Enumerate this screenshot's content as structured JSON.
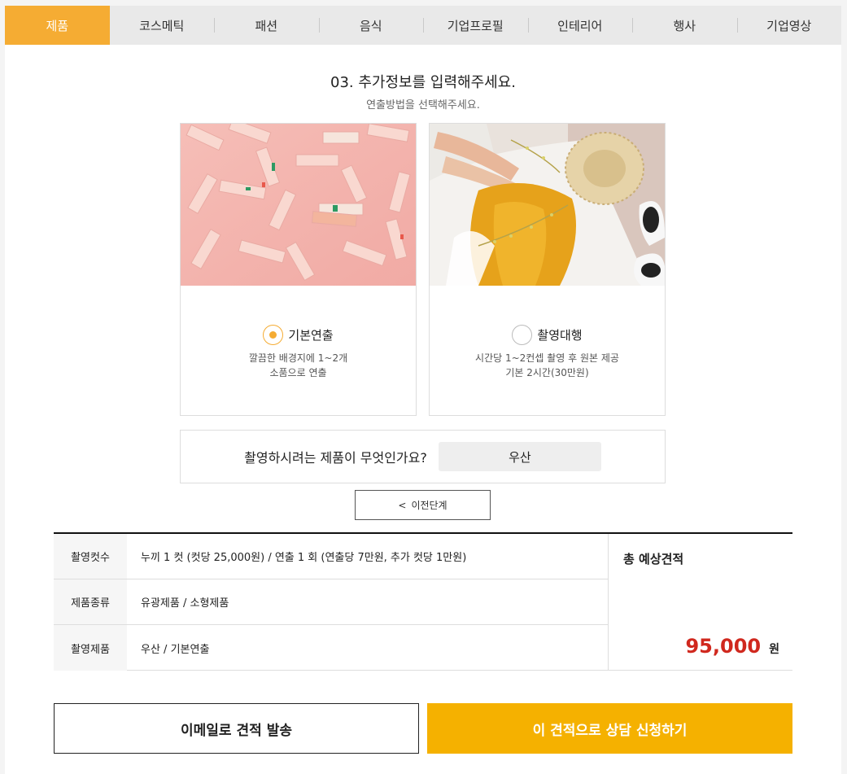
{
  "tabs": [
    {
      "label": "제품",
      "active": true
    },
    {
      "label": "코스메틱"
    },
    {
      "label": "패션"
    },
    {
      "label": "음식"
    },
    {
      "label": "기업프로필"
    },
    {
      "label": "인테리어"
    },
    {
      "label": "행사"
    },
    {
      "label": "기업영상"
    }
  ],
  "step": {
    "title": "03. 추가정보를 입력해주세요.",
    "subtitle": "연출방법을 선택해주세요."
  },
  "options": [
    {
      "label": "기본연출",
      "desc_line1": "깔끔한 배경지에 1~2개",
      "desc_line2": "소품으로 연출",
      "selected": true,
      "image": "pink-cosmetics-photo"
    },
    {
      "label": "촬영대행",
      "desc_line1": "시간당 1~2컨셉 촬영 후 원본 제공",
      "desc_line2": "기본 2시간(30만원)",
      "selected": false,
      "image": "picnic-clothes-photo"
    }
  ],
  "question": {
    "label": "촬영하시려는 제품이 무엇인가요?",
    "answer": "우산"
  },
  "prev_button": {
    "arrow": "<",
    "label": "이전단계"
  },
  "summary": {
    "rows": [
      {
        "key": "촬영컷수",
        "value": "누끼 1 컷 (컷당 25,000원) / 연출 1 회 (연출당 7만원, 추가 컷당 1만원)"
      },
      {
        "key": "제품종류",
        "value": "유광제품 / 소형제품"
      },
      {
        "key": "촬영제품",
        "value": "우산 / 기본연출"
      }
    ],
    "total_label": "총 예상견적",
    "total_amount": "95,000",
    "total_unit": "원"
  },
  "buttons": {
    "email": "이메일로 견적 발송",
    "apply": "이 견적으로 상담 신청하기"
  },
  "colors": {
    "accent": "#f5ac33",
    "apply_button": "#f5b100",
    "total_price": "#d0281e"
  }
}
